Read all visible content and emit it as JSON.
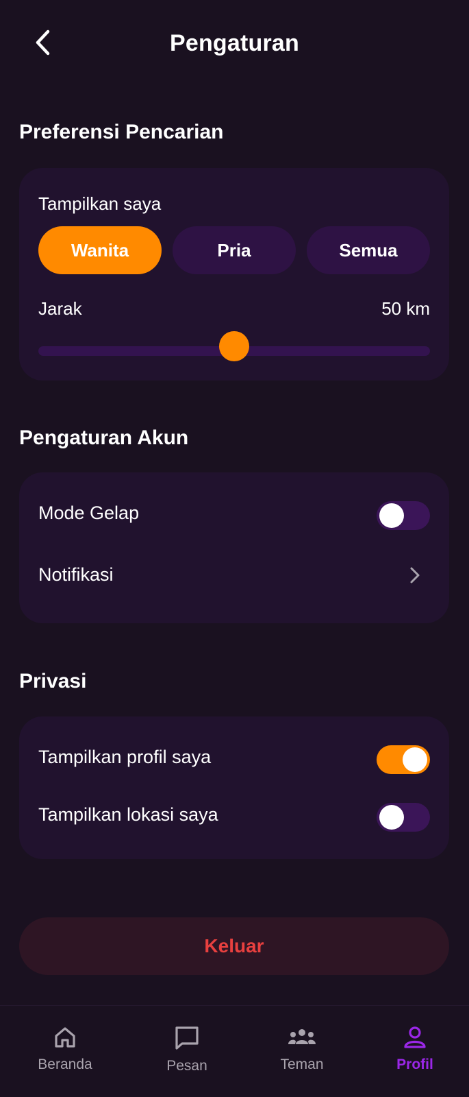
{
  "header": {
    "title": "Pengaturan"
  },
  "search_prefs": {
    "section_title": "Preferensi Pencarian",
    "show_me_label": "Tampilkan saya",
    "options": [
      "Wanita",
      "Pria",
      "Semua"
    ],
    "selected": "Wanita",
    "distance_label": "Jarak",
    "distance_value": "50 km",
    "distance_fraction": 0.5
  },
  "account": {
    "section_title": "Pengaturan Akun",
    "dark_mode_label": "Mode Gelap",
    "dark_mode_on": false,
    "notifications_label": "Notifikasi"
  },
  "privacy": {
    "section_title": "Privasi",
    "show_profile_label": "Tampilkan profil saya",
    "show_profile_on": true,
    "show_location_label": "Tampilkan lokasi saya",
    "show_location_on": false
  },
  "logout_label": "Keluar",
  "nav": {
    "items": [
      {
        "label": "Beranda",
        "icon": "home-icon"
      },
      {
        "label": "Pesan",
        "icon": "message-icon"
      },
      {
        "label": "Teman",
        "icon": "friends-icon"
      },
      {
        "label": "Profil",
        "icon": "profile-icon"
      }
    ],
    "active": "Profil"
  },
  "colors": {
    "background": "#1a1120",
    "card": "#21122e",
    "accent": "#ff8a00",
    "nav_active": "#9b27e8",
    "danger": "#e8403f"
  }
}
